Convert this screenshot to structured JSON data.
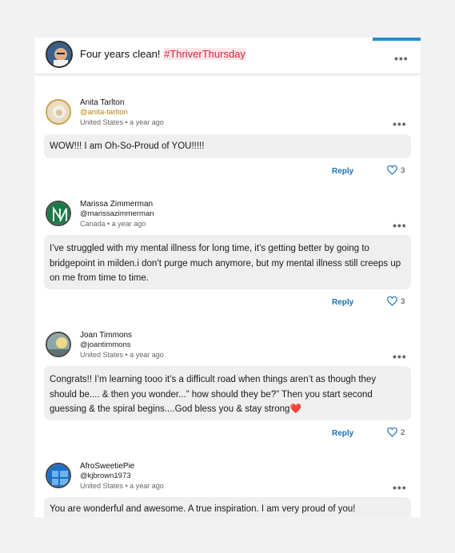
{
  "post": {
    "title_text": "Four years clean!",
    "hashtag": "#ThriverThursday",
    "more_label": "•••"
  },
  "comments": [
    {
      "name": "Anita Tarlton",
      "handle": "@anita-tarlton",
      "meta": "United States • a year ago",
      "text": "WOW!!! I am Oh-So-Proud of YOU!!!!!",
      "reply_label": "Reply",
      "likes": "3",
      "more_label": "•••"
    },
    {
      "name": "Marissa Zimmerman",
      "handle": "@marissazimmerman",
      "meta": "Canada • a year ago",
      "text": "I’ve struggled with my mental illness for long time, it’s getting better by going to bridgepoint in milden.i don’t purge much anymore, but my mental illness still creeps up on me from time to time.",
      "reply_label": "Reply",
      "likes": "3",
      "more_label": "•••"
    },
    {
      "name": "Joan Timmons",
      "handle": "@joantimmons",
      "meta": "United States • a year ago",
      "text": "Congrats!! I’m learning tooo it’s a difficult road when things aren’t as though they should be.... & then you wonder...” how should they be?” Then you start second guessing & the spiral begins....God bless you & stay strong❤️",
      "reply_label": "Reply",
      "likes": "2",
      "more_label": "•••"
    },
    {
      "name": "AfroSweetiePie",
      "handle": "@kjbrown1973",
      "meta": "United States • a year ago",
      "text": "You are wonderful and awesome. A true inspiration. I am very proud of you!",
      "more_label": "•••"
    }
  ],
  "colors": {
    "hashtag": "#d8233a",
    "reply": "#1a72b8",
    "heart": "#1a72b8",
    "accent": "#1f8fd6"
  },
  "icons": [
    "more-options-icon",
    "heart-icon"
  ]
}
